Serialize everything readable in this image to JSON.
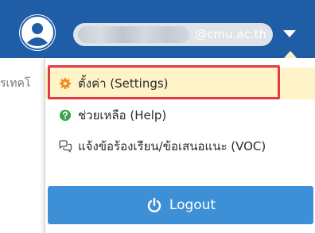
{
  "header": {
    "user_email_domain": "@cmu.ac.th"
  },
  "background": {
    "partial_text": "รเทคโ"
  },
  "menu": {
    "items": [
      {
        "label": "ตั้งค่า (Settings)",
        "icon": "gear-icon"
      },
      {
        "label": "ช่วยเหลือ (Help)",
        "icon": "question-circle-icon"
      },
      {
        "label": "แจ้งข้อร้องเรียน/ข้อเสนอแนะ (VOC)",
        "icon": "chat-bubbles-icon"
      }
    ],
    "logout_label": "Logout"
  },
  "colors": {
    "topbar": "#1f5da6",
    "settings_highlight": "#fff3c8",
    "highlight_border": "#e13b48",
    "logout_button": "#3d8fd6",
    "gear_icon": "#f08a1d",
    "help_icon": "#3aa44a"
  }
}
